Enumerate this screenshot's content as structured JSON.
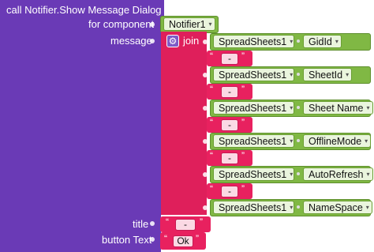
{
  "call": {
    "title": "call Notifier.Show Message Dialog",
    "for_component": "for component",
    "message": "message",
    "title_label": "title",
    "button_text_label": "button Text"
  },
  "component_value": "Notifier1",
  "join_label": "join",
  "gear_glyph": "⚙",
  "caret_glyph": "▾",
  "quote_open": "“",
  "quote_close": "”",
  "join_items": [
    {
      "component": "SpreadSheets1",
      "property": "GidId"
    },
    {
      "separator": "-"
    },
    {
      "component": "SpreadSheets1",
      "property": "SheetId"
    },
    {
      "separator": "-"
    },
    {
      "component": "SpreadSheets1",
      "property": "Sheet Name"
    },
    {
      "separator": "-"
    },
    {
      "component": "SpreadSheets1",
      "property": "OfflineMode"
    },
    {
      "separator": "-"
    },
    {
      "component": "SpreadSheets1",
      "property": "AutoRefresh"
    },
    {
      "separator": "-"
    },
    {
      "component": "SpreadSheets1",
      "property": "NameSpace"
    }
  ],
  "title_value": "-",
  "button_text_value": "Ok",
  "colors": {
    "procedure_purple": "#6A3AB6",
    "text_pink": "#DF1F5B",
    "component_green": "#80B844"
  }
}
